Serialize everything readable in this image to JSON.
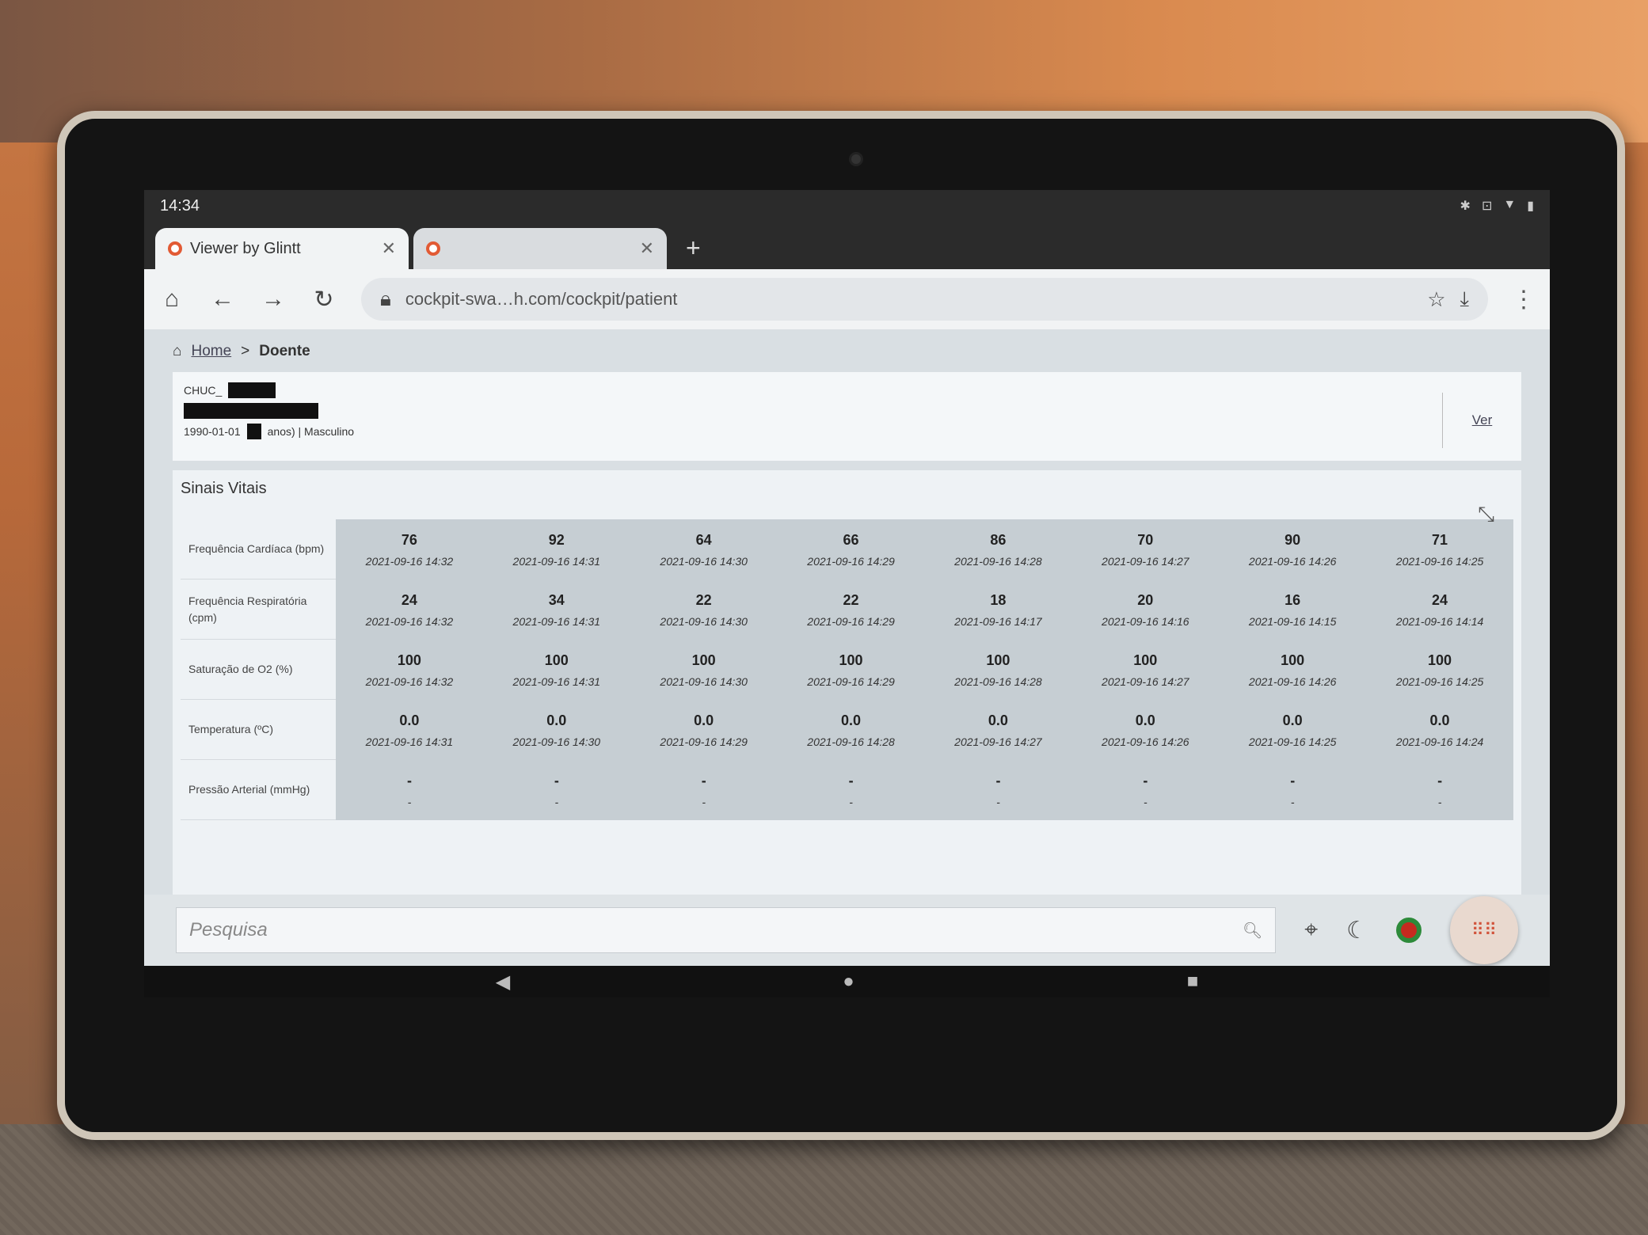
{
  "status_bar": {
    "time": "14:34",
    "icons": [
      "bluetooth-icon",
      "vibrate-icon",
      "wifi-icon",
      "battery-icon"
    ]
  },
  "tabs": [
    {
      "title": "Viewer by Glintt",
      "active": true
    },
    {
      "title": "",
      "active": false
    }
  ],
  "toolbar": {
    "url": "cockpit-swa…h.com/cockpit/patient"
  },
  "breadcrumb": {
    "home": "Home",
    "separator": ">",
    "current": "Doente"
  },
  "patient": {
    "id_prefix": "CHUC_",
    "birth_date": "1990-01-01",
    "age_suffix": "anos) | Masculino",
    "view_link": "Ver"
  },
  "vitals": {
    "title": "Sinais Vitais",
    "rows": [
      {
        "label": "Frequência Cardíaca (bpm)",
        "cells": [
          {
            "v": "76",
            "t": "2021-09-16 14:32"
          },
          {
            "v": "92",
            "t": "2021-09-16 14:31"
          },
          {
            "v": "64",
            "t": "2021-09-16 14:30"
          },
          {
            "v": "66",
            "t": "2021-09-16 14:29"
          },
          {
            "v": "86",
            "t": "2021-09-16 14:28"
          },
          {
            "v": "70",
            "t": "2021-09-16 14:27"
          },
          {
            "v": "90",
            "t": "2021-09-16 14:26"
          },
          {
            "v": "71",
            "t": "2021-09-16 14:25"
          }
        ]
      },
      {
        "label": "Frequência Respiratória (cpm)",
        "cells": [
          {
            "v": "24",
            "t": "2021-09-16 14:32"
          },
          {
            "v": "34",
            "t": "2021-09-16 14:31"
          },
          {
            "v": "22",
            "t": "2021-09-16 14:30"
          },
          {
            "v": "22",
            "t": "2021-09-16 14:29"
          },
          {
            "v": "18",
            "t": "2021-09-16 14:17"
          },
          {
            "v": "20",
            "t": "2021-09-16 14:16"
          },
          {
            "v": "16",
            "t": "2021-09-16 14:15"
          },
          {
            "v": "24",
            "t": "2021-09-16 14:14"
          }
        ]
      },
      {
        "label": "Saturação de O2 (%)",
        "cells": [
          {
            "v": "100",
            "t": "2021-09-16 14:32"
          },
          {
            "v": "100",
            "t": "2021-09-16 14:31"
          },
          {
            "v": "100",
            "t": "2021-09-16 14:30"
          },
          {
            "v": "100",
            "t": "2021-09-16 14:29"
          },
          {
            "v": "100",
            "t": "2021-09-16 14:28"
          },
          {
            "v": "100",
            "t": "2021-09-16 14:27"
          },
          {
            "v": "100",
            "t": "2021-09-16 14:26"
          },
          {
            "v": "100",
            "t": "2021-09-16 14:25"
          }
        ]
      },
      {
        "label": "Temperatura (ºC)",
        "cells": [
          {
            "v": "0.0",
            "t": "2021-09-16 14:31"
          },
          {
            "v": "0.0",
            "t": "2021-09-16 14:30"
          },
          {
            "v": "0.0",
            "t": "2021-09-16 14:29"
          },
          {
            "v": "0.0",
            "t": "2021-09-16 14:28"
          },
          {
            "v": "0.0",
            "t": "2021-09-16 14:27"
          },
          {
            "v": "0.0",
            "t": "2021-09-16 14:26"
          },
          {
            "v": "0.0",
            "t": "2021-09-16 14:25"
          },
          {
            "v": "0.0",
            "t": "2021-09-16 14:24"
          }
        ]
      },
      {
        "label": "Pressão Arterial (mmHg)",
        "cells": [
          {
            "v": "-",
            "t": "-"
          },
          {
            "v": "-",
            "t": "-"
          },
          {
            "v": "-",
            "t": "-"
          },
          {
            "v": "-",
            "t": "-"
          },
          {
            "v": "-",
            "t": "-"
          },
          {
            "v": "-",
            "t": "-"
          },
          {
            "v": "-",
            "t": "-"
          },
          {
            "v": "-",
            "t": "-"
          }
        ]
      }
    ]
  },
  "search": {
    "placeholder": "Pesquisa"
  },
  "colors": {
    "accent": "#e25a34",
    "grid_bg": "#c6ced3"
  }
}
